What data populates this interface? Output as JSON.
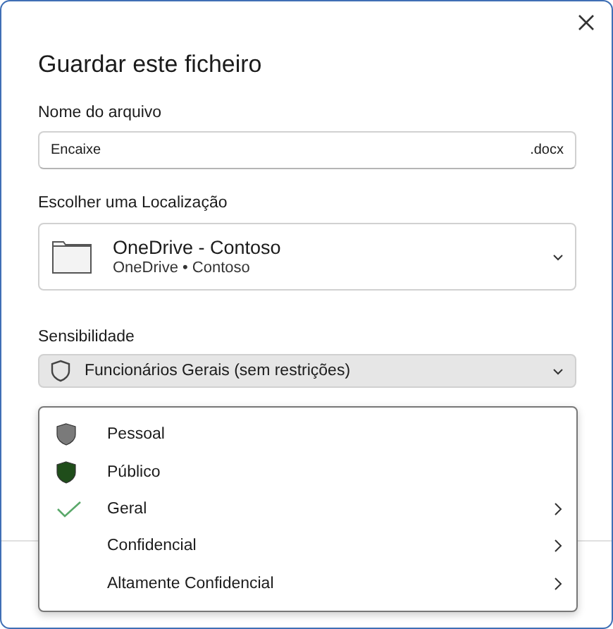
{
  "dialog": {
    "title": "Guardar este ficheiro"
  },
  "file_name": {
    "label": "Nome do arquivo",
    "value": "Encaixe",
    "extension": ".docx"
  },
  "location": {
    "label": "Escolher uma Localização",
    "name": "OneDrive - Contoso",
    "path": "OneDrive • Contoso"
  },
  "sensitivity": {
    "label": "Sensibilidade",
    "value": "Funcionários Gerais (sem restrições)",
    "expanded": true
  },
  "menu": [
    {
      "kind": "shield",
      "label": "Pessoal",
      "color": "#7a7a7a",
      "selected": false,
      "submenu": false
    },
    {
      "kind": "shield",
      "label": "Público",
      "color": "#1f4d1a",
      "selected": false,
      "submenu": false
    },
    {
      "kind": "plain",
      "label": "Geral",
      "selected": true,
      "submenu": true
    },
    {
      "kind": "plain",
      "label": "Confidencial",
      "selected": false,
      "submenu": true
    },
    {
      "kind": "plain",
      "label": "Altamente Confidencial",
      "selected": false,
      "submenu": true
    }
  ]
}
